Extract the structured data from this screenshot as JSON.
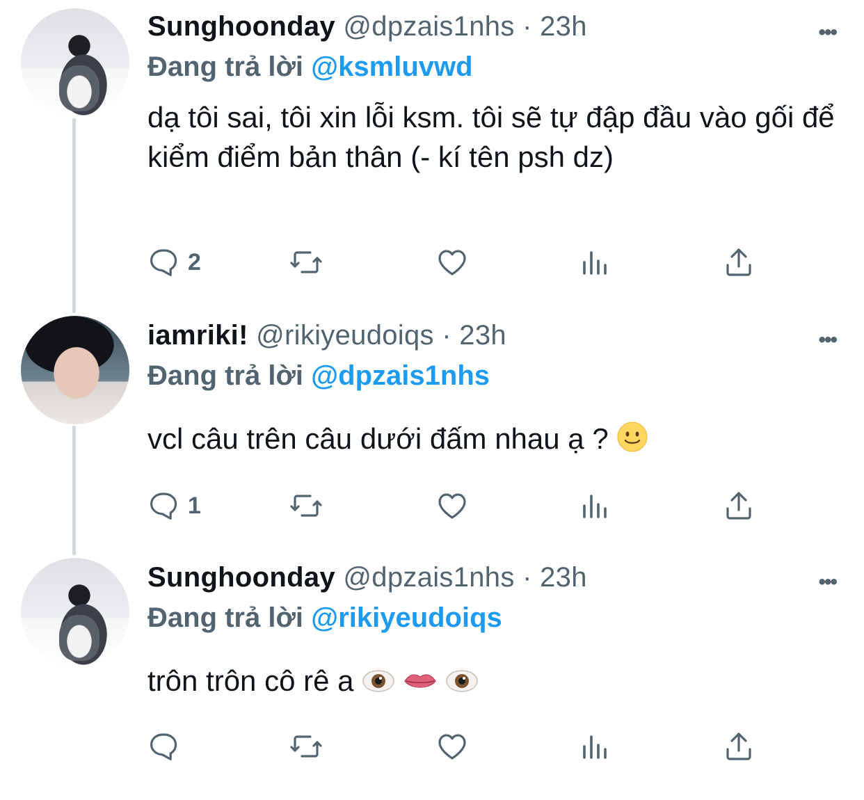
{
  "tweets": [
    {
      "name": "Sunghoonday",
      "handle": "@dpzais1nhs",
      "sep": "·",
      "time": "23h",
      "reply_prefix": "Đang trả lời",
      "reply_to": "@ksmluvwd",
      "text": "dạ tôi sai, tôi xin lỗi ksm. tôi sẽ tự đập đầu vào gối để kiểm điểm bản thân (- kí tên psh dz)",
      "reply_count": "2",
      "avatar": "light"
    },
    {
      "name": "iamriki!",
      "handle": "@rikiyeudoiqs",
      "sep": "·",
      "time": "23h",
      "reply_prefix": "Đang trả lời",
      "reply_to": "@dpzais1nhs",
      "text": "vcl câu trên câu dưới đấm nhau ạ ?",
      "text_emojis": [
        "slightly-smiling-face-emoji"
      ],
      "reply_count": "1",
      "avatar": "dark"
    },
    {
      "name": "Sunghoonday",
      "handle": "@dpzais1nhs",
      "sep": "·",
      "time": "23h",
      "reply_prefix": "Đang trả lời",
      "reply_to": "@rikiyeudoiqs",
      "text": "trôn trôn cô rê a",
      "text_emojis": [
        "eye-emoji",
        "lips-emoji",
        "eye-emoji"
      ],
      "reply_count": "",
      "avatar": "light"
    }
  ],
  "icons": {
    "reply": "speech-bubble-icon",
    "retweet": "retweet-icon",
    "like": "heart-icon",
    "views": "bar-chart-icon",
    "share": "share-upload-icon",
    "more": "ellipsis-icon"
  },
  "colors": {
    "text": "#0f1419",
    "secondary": "#536471",
    "mention": "#1d9bf0",
    "thread_line": "#cfd9de"
  }
}
